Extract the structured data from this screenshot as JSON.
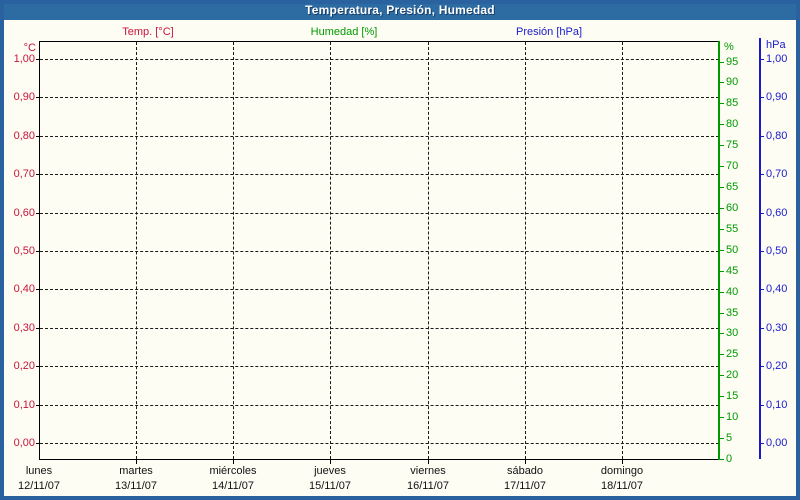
{
  "window": {
    "title": "Temperatura, Presión, Humedad",
    "titlebar_color": "#2d6ba3",
    "frame_color": "#2a62a0",
    "background_color": "#fdfdf4"
  },
  "legend": {
    "items": [
      {
        "label": "Temp. [°C]",
        "color": "#c8143c"
      },
      {
        "label": "Humedad [%]",
        "color": "#009900"
      },
      {
        "label": "Presión [hPa]",
        "color": "#1a1acc"
      }
    ]
  },
  "axes": {
    "temperature": {
      "unit_label": "°C",
      "color": "#c8143c",
      "tick_labels": [
        "1,00",
        "0,90",
        "0,80",
        "0,70",
        "0,60",
        "0,50",
        "0,40",
        "0,30",
        "0,20",
        "0,10",
        "0,00"
      ]
    },
    "humidity": {
      "unit_label": "%",
      "color": "#009900",
      "tick_labels": [
        "95",
        "90",
        "85",
        "80",
        "75",
        "70",
        "65",
        "60",
        "55",
        "50",
        "45",
        "40",
        "35",
        "30",
        "25",
        "20",
        "15",
        "10",
        "5",
        "0"
      ]
    },
    "pressure": {
      "unit_label": "hPa",
      "color": "#1a1acc",
      "tick_labels": [
        "1,00",
        "0,90",
        "0,80",
        "0,70",
        "0,60",
        "0,50",
        "0,40",
        "0,30",
        "0,20",
        "0,10",
        "0,00"
      ]
    }
  },
  "x_axis": {
    "days": [
      {
        "name": "lunes",
        "date": "12/11/07"
      },
      {
        "name": "martes",
        "date": "13/11/07"
      },
      {
        "name": "miércoles",
        "date": "14/11/07"
      },
      {
        "name": "jueves",
        "date": "15/11/07"
      },
      {
        "name": "viernes",
        "date": "16/11/07"
      },
      {
        "name": "sábado",
        "date": "17/11/07"
      },
      {
        "name": "domingo",
        "date": "18/11/07"
      }
    ]
  },
  "chart_data": {
    "type": "line",
    "title": "Temperatura, Presión, Humedad",
    "x_categories": [
      "lunes 12/11/07",
      "martes 13/11/07",
      "miércoles 14/11/07",
      "jueves 15/11/07",
      "viernes 16/11/07",
      "sábado 17/11/07",
      "domingo 18/11/07"
    ],
    "series": [
      {
        "name": "Temp. [°C]",
        "y_axis": "temperature",
        "color": "#c8143c",
        "values": []
      },
      {
        "name": "Humedad [%]",
        "y_axis": "humidity",
        "color": "#009900",
        "values": []
      },
      {
        "name": "Presión [hPa]",
        "y_axis": "pressure",
        "color": "#1a1acc",
        "values": []
      }
    ],
    "y_axes": [
      {
        "id": "temperature",
        "unit": "°C",
        "position": "left",
        "min": 0.0,
        "max": 1.0,
        "step": 0.1,
        "decimal_separator": ","
      },
      {
        "id": "humidity",
        "unit": "%",
        "position": "right-inner",
        "min": 0,
        "max": 95,
        "step": 5
      },
      {
        "id": "pressure",
        "unit": "hPa",
        "position": "right-outer",
        "min": 0.0,
        "max": 1.0,
        "step": 0.1,
        "decimal_separator": ","
      }
    ],
    "grid": {
      "horizontal": "dashed",
      "vertical": "dashed",
      "legend_position": "top"
    },
    "note": "empty chart - no data points plotted"
  }
}
